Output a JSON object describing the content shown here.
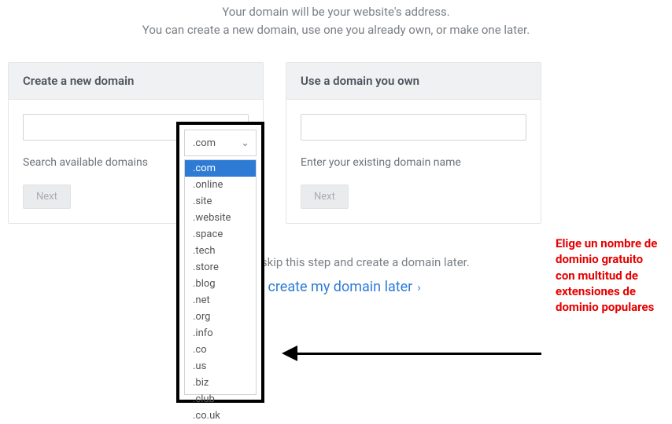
{
  "header": {
    "line1": "Your domain will be your website's address.",
    "line2": "You can create a new domain, use one you already own, or make one later."
  },
  "create": {
    "title": "Create a new domain",
    "helper": "Search available domains",
    "next": "Next",
    "tld_selected": ".com"
  },
  "own": {
    "title": "Use a domain you own",
    "helper": "Enter your existing domain name",
    "next": "Next"
  },
  "later": {
    "text": "Or you can skip this step and create a domain later.",
    "link": "I'll create my domain later"
  },
  "dropdown": {
    "selected": ".com",
    "options": [
      ".com",
      ".online",
      ".site",
      ".website",
      ".space",
      ".tech",
      ".store",
      ".blog",
      ".net",
      ".org",
      ".info",
      ".co",
      ".us",
      ".biz",
      ".club",
      ".co.uk"
    ]
  },
  "annotation": {
    "text": "Elige un nombre de dominio gratuito con multitud de extensiones de dominio populares"
  }
}
